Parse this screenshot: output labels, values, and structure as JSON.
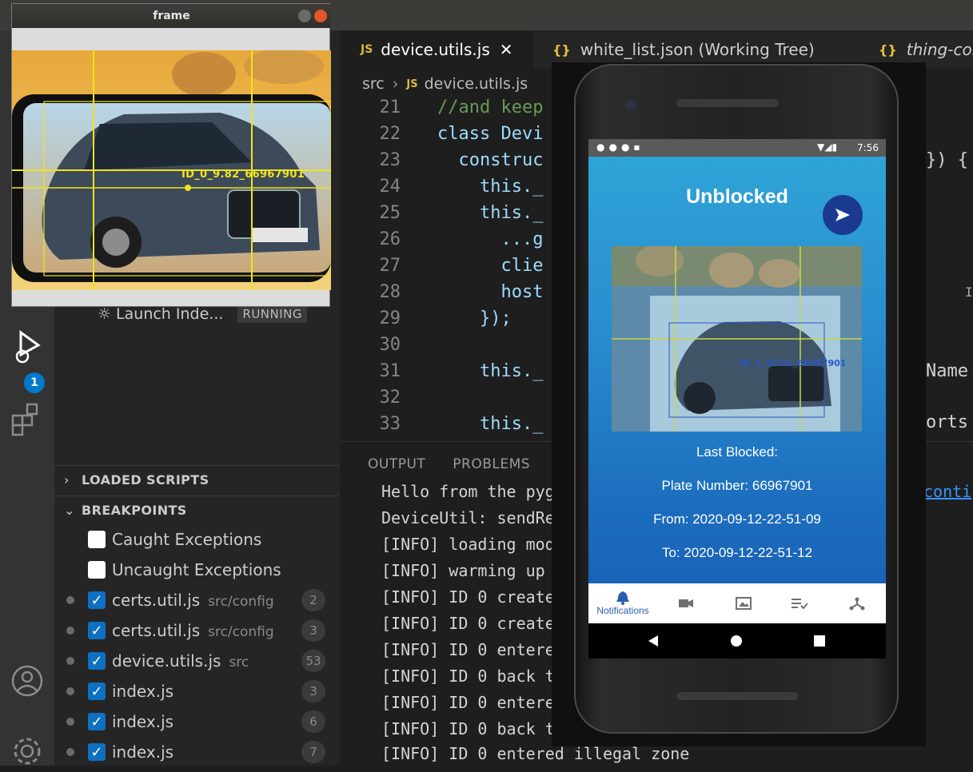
{
  "frame_window": {
    "title": "frame",
    "detection_label": "ID_0_9.82_66967901",
    "overlay_color": "#f0e41a"
  },
  "editor_tabs": [
    {
      "icon": "JS",
      "label": "device.utils.js",
      "close": "✕"
    },
    {
      "icon": "{}",
      "label": "white_list.json (Working Tree)"
    },
    {
      "icon": "{}",
      "label": "thing-cor"
    }
  ],
  "breadcrumb": {
    "folder": "src",
    "sep": "›",
    "icon": "JS",
    "file": "device.utils.js"
  },
  "code_lines": [
    {
      "n": "21",
      "text": "//and keep"
    },
    {
      "n": "22",
      "text": "class Devi"
    },
    {
      "n": "23",
      "text": "  construc"
    },
    {
      "n": "24",
      "text": "    this._"
    },
    {
      "n": "25",
      "text": "    this._"
    },
    {
      "n": "26",
      "text": "      ...g"
    },
    {
      "n": "27",
      "text": "      clie"
    },
    {
      "n": "28",
      "text": "      host"
    },
    {
      "n": "29",
      "text": "    });"
    },
    {
      "n": "30",
      "text": ""
    },
    {
      "n": "31",
      "text": "    this._"
    },
    {
      "n": "32",
      "text": ""
    },
    {
      "n": "33",
      "text": "    this._"
    }
  ],
  "code_right": {
    "line23": "}) {",
    "line31": "Name",
    "line33": "orts"
  },
  "cursor_glyph": "I",
  "panel": {
    "tabs": [
      "OUTPUT",
      "PROBLEMS"
    ],
    "output": [
      "Hello from the pyg",
      "DeviceUtil: sendRe",
      "[INFO] loading mod",
      "[INFO] warming up",
      "[INFO] ID 0 create",
      "[INFO] ID 0 create",
      "[INFO] ID 0 entere",
      "[INFO] ID 0 back t",
      "[INFO] ID 0 entere",
      "[INFO] ID 0 back t",
      "[INFO] ID 0 entered illegal zone"
    ],
    "link_fragment": "conti"
  },
  "activity": {
    "debug_badge": "1"
  },
  "sidebar": {
    "launch": {
      "label": "Launch Inde...",
      "status": "RUNNING"
    },
    "loaded_scripts": "LOADED SCRIPTS",
    "breakpoints_header": "BREAKPOINTS",
    "exceptions": [
      "Caught Exceptions",
      "Uncaught Exceptions"
    ],
    "breakpoints": [
      {
        "file": "certs.util.js",
        "path": "src/config",
        "line": "2"
      },
      {
        "file": "certs.util.js",
        "path": "src/config",
        "line": "3"
      },
      {
        "file": "device.utils.js",
        "path": "src",
        "line": "53"
      },
      {
        "file": "index.js",
        "path": "",
        "line": "3"
      },
      {
        "file": "index.js",
        "path": "",
        "line": "6"
      },
      {
        "file": "index.js",
        "path": "",
        "line": "7"
      }
    ]
  },
  "phone": {
    "clock": "7:56",
    "title": "Unblocked",
    "snapshot_label": "ID_1_10.02_66967901",
    "last_blocked": "Last Blocked:",
    "plate": "Plate Number: 66967901",
    "from": "From: 2020-09-12-22-51-09",
    "to": "To: 2020-09-12-22-51-12",
    "nav_active_label": "Notifications",
    "nav_icons": [
      "bell-icon",
      "video-icon",
      "image-icon",
      "playlist-icon",
      "hub-icon"
    ]
  }
}
